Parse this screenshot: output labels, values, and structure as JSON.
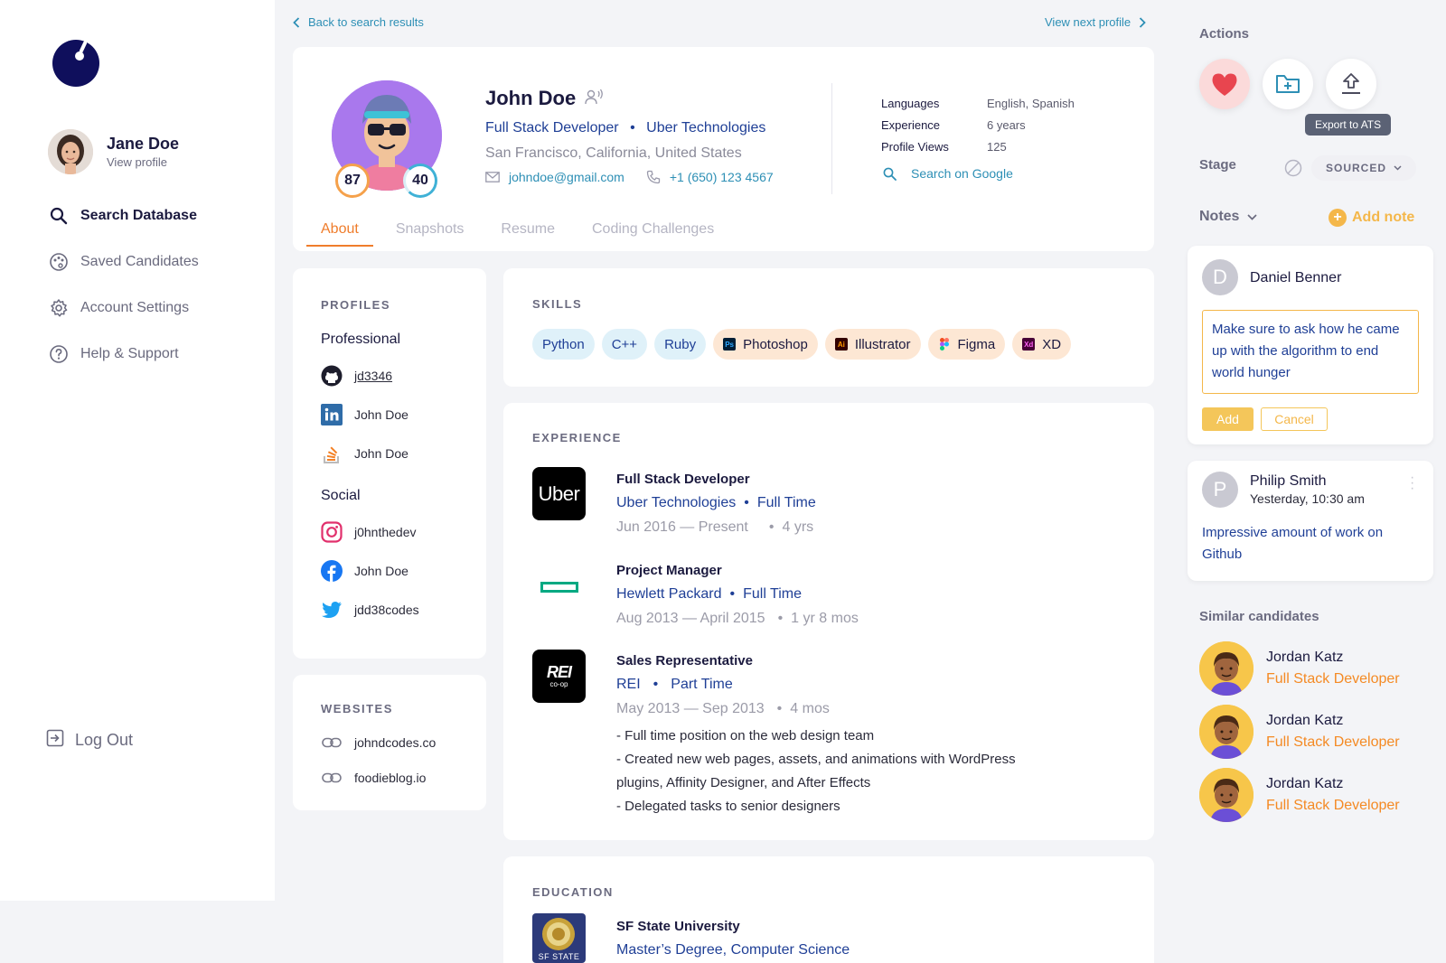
{
  "sidebar": {
    "user_name": "Jane Doe",
    "user_link": "View profile",
    "nav": [
      {
        "label": "Search Database",
        "icon": "search-icon",
        "active": true
      },
      {
        "label": "Saved Candidates",
        "icon": "palette-icon",
        "active": false
      },
      {
        "label": "Account Settings",
        "icon": "gear-icon",
        "active": false
      },
      {
        "label": "Help & Support",
        "icon": "help-icon",
        "active": false
      }
    ],
    "logout": "Log Out"
  },
  "topnav": {
    "back": "Back to search results",
    "next": "View next profile"
  },
  "candidate": {
    "name": "John Doe",
    "role": "Full Stack Developer",
    "company": "Uber Technologies",
    "location": "San Francisco, California, United States",
    "email": "johndoe@gmail.com",
    "phone": "+1 (650) 123 4567",
    "score_1": "87",
    "score_2": "40",
    "facts": [
      {
        "key": "Languages",
        "value": "English, Spanish"
      },
      {
        "key": "Experience",
        "value": "6 years"
      },
      {
        "key": "Profile Views",
        "value": "125"
      }
    ],
    "google": "Search on Google"
  },
  "tabs": [
    "About",
    "Snapshots",
    "Resume",
    "Coding Challenges"
  ],
  "profiles": {
    "title": "PROFILES",
    "professional_label": "Professional",
    "professional": [
      {
        "icon": "github-icon",
        "label": "jd3346"
      },
      {
        "icon": "linkedin-icon",
        "label": "John Doe"
      },
      {
        "icon": "stackoverflow-icon",
        "label": "John Doe"
      }
    ],
    "social_label": "Social",
    "social": [
      {
        "icon": "instagram-icon",
        "label": "j0hnthedev"
      },
      {
        "icon": "facebook-icon",
        "label": "John Doe"
      },
      {
        "icon": "twitter-icon",
        "label": "jdd38codes"
      }
    ]
  },
  "websites": {
    "title": "WEBSITES",
    "items": [
      "johndcodes.co",
      "foodieblog.io"
    ]
  },
  "skills": {
    "title": "SKILLS",
    "items": [
      "Python",
      "C++",
      "Ruby",
      "Photoshop",
      "Illustrator",
      "Figma",
      "XD"
    ]
  },
  "experience": {
    "title": "EXPERIENCE",
    "jobs": [
      {
        "title": "Full Stack Developer",
        "company": "Uber Technologies",
        "type": "Full Time",
        "dates": "Jun 2016 — Present",
        "duration": "4 yrs",
        "logo_text": "Uber"
      },
      {
        "title": "Project Manager",
        "company": "Hewlett Packard",
        "type": "Full Time",
        "dates": "Aug 2013 — April 2015",
        "duration": "1 yr 8 mos"
      },
      {
        "title": "Sales Representative",
        "company": "REI",
        "type": "Part Time",
        "dates": "May 2013 — Sep 2013",
        "duration": "4 mos",
        "logo_text": "REI",
        "logo_subtext": "co-op",
        "desc": [
          "- Full time position on the web design team",
          "- Created new web pages, assets, and animations with WordPress",
          "plugins, Affinity Designer, and After Effects",
          "- Delegated tasks to senior designers"
        ]
      }
    ]
  },
  "education": {
    "title": "EDUCATION",
    "school": "SF State University",
    "degree": "Master’s Degree, Computer Science",
    "seal_text": "SF STATE"
  },
  "actions": {
    "title": "Actions",
    "tooltip": "Export to ATS",
    "stage_label": "Stage",
    "stage_value": "SOURCED",
    "notes_label": "Notes",
    "add_note": "Add note"
  },
  "notes": [
    {
      "initial": "D",
      "author": "Daniel Benner",
      "draft": "Make sure to ask how he came up with the algorithm to end world hunger",
      "add": "Add",
      "cancel": "Cancel"
    },
    {
      "initial": "P",
      "author": "Philip Smith",
      "time": "Yesterday, 10:30 am",
      "text": "Impressive amount of work on Github"
    }
  ],
  "similar": {
    "title": "Similar candidates",
    "items": [
      {
        "name": "Jordan Katz",
        "role": "Full Stack Developer"
      },
      {
        "name": "Jordan Katz",
        "role": "Full Stack Developer"
      },
      {
        "name": "Jordan Katz",
        "role": "Full Stack Developer"
      }
    ]
  },
  "colors": {
    "accent_orange": "#ef7d2c",
    "link_teal": "#2d8fb5",
    "navy": "#1b1a3f",
    "note_yellow": "#f4b74a"
  }
}
